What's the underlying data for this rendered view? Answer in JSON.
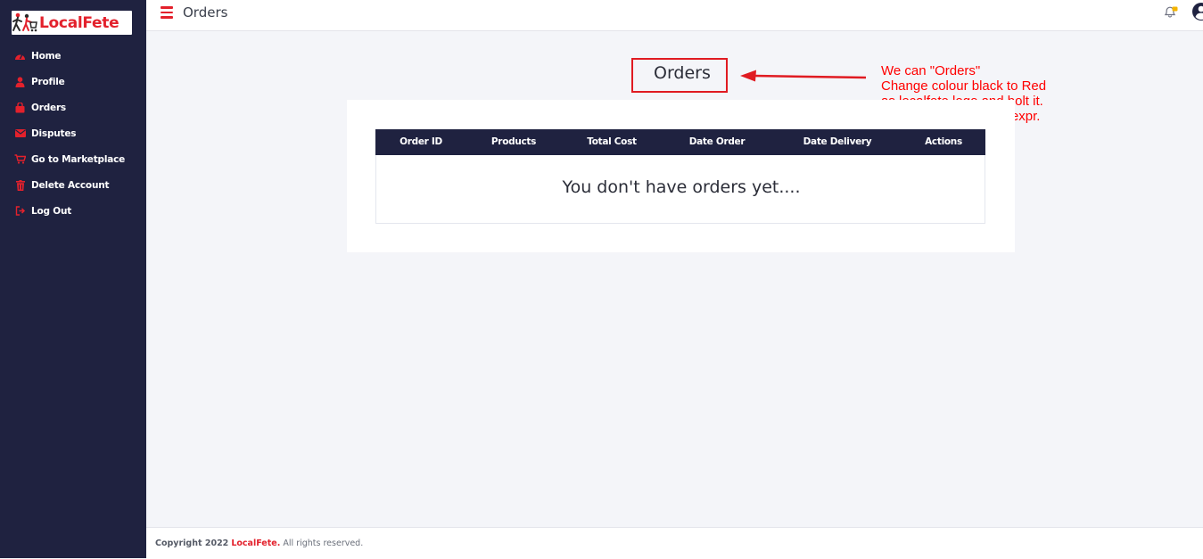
{
  "brand": {
    "logo_text": "LocalFete",
    "accent_color": "#e3212c",
    "sidebar_bg": "#1f2240"
  },
  "sidebar": {
    "items": [
      {
        "label": "Home",
        "icon": "dashboard-icon"
      },
      {
        "label": "Profile",
        "icon": "user-icon"
      },
      {
        "label": "Orders",
        "icon": "shopping-bag-icon"
      },
      {
        "label": "Disputes",
        "icon": "envelope-icon"
      },
      {
        "label": "Go to Marketplace",
        "icon": "cart-icon"
      },
      {
        "label": "Delete Account",
        "icon": "trash-icon"
      },
      {
        "label": "Log Out",
        "icon": "sign-out-icon"
      }
    ]
  },
  "topbar": {
    "title": "Orders",
    "menu_icon": "hamburger-icon",
    "notification_icon": "bell-icon",
    "profile_icon": "user-circle-icon"
  },
  "main": {
    "heading": "Orders",
    "table": {
      "columns": [
        "Order ID",
        "Products",
        "Total Cost",
        "Date Order",
        "Date Delivery",
        "Actions"
      ],
      "empty_message": "You don't have orders yet...."
    }
  },
  "annotation": {
    "lines": [
      "We can \"Orders\"",
      "Change colour black to Red",
      "as localfete logo and bolt it.",
      "I think It give more UI expr."
    ],
    "color": "#ff0000"
  },
  "footer": {
    "prefix": "Copyright 2022",
    "brand": "LocalFete.",
    "suffix": "All rights reserved."
  }
}
